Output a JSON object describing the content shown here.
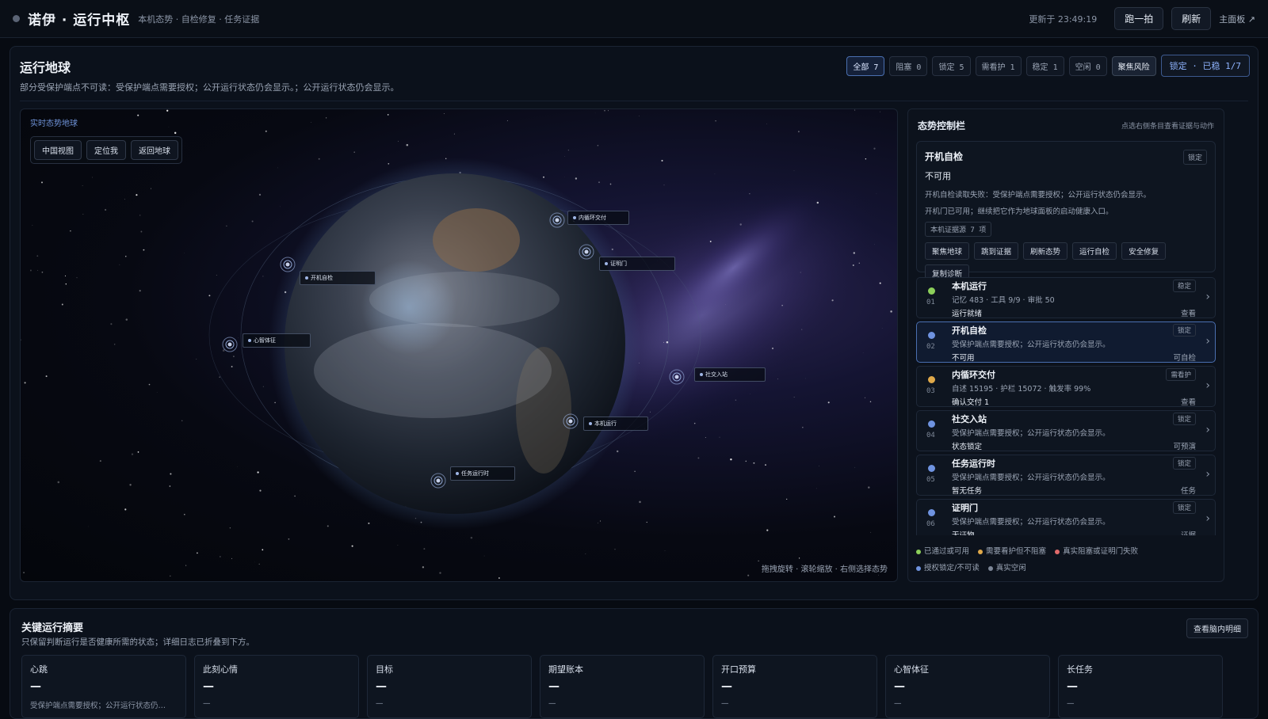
{
  "topbar": {
    "brand": "诺伊 · 运行中枢",
    "subtitle": "本机态势 · 自检修复 · 任务证据",
    "updated": "更新于 23:49:19",
    "btn_snapshot": "跑一拍",
    "btn_refresh": "刷新",
    "link_main": "主面板 ↗"
  },
  "panel": {
    "title": "运行地球",
    "desc": "部分受保护端点不可读：受保护端点需要授权；公开运行状态仍会显示。；公开运行状态仍会显示。",
    "filters": [
      "全部 7",
      "阻塞 0",
      "锁定 5",
      "需看护 1",
      "稳定 1",
      "空闲 0"
    ],
    "focus_risk": "聚焦风险",
    "lock_status": "锁定 · 已稳 1/7"
  },
  "globe": {
    "label": "实时态势地球",
    "btn_china": "中国视图",
    "btn_locate": "定位我",
    "btn_earth": "返回地球",
    "hint": "拖拽旋转 · 滚轮缩放 · 右侧选择态势",
    "nodes": [
      "开机自检",
      "内循环交付",
      "证明门",
      "心智体征",
      "社交入站",
      "本机运行",
      "任务运行时"
    ]
  },
  "side": {
    "title": "态势控制栏",
    "hint": "点选右侧条目查看证据与动作",
    "detail": {
      "title": "开机自检",
      "badge": "锁定",
      "state": "不可用",
      "line1": "开机自检读取失败：受保护端点需要授权；公开运行状态仍会显示。",
      "line2": "开机门已可用；继续把它作为地球面板的启动健康入口。",
      "source": "本机证据源 7 项",
      "actions": [
        "聚焦地球",
        "跳到证据",
        "刷新态势",
        "运行自检",
        "安全修复",
        "复制诊断"
      ]
    },
    "rows": [
      {
        "num": "01",
        "title": "本机运行",
        "badge": "稳定",
        "sub": "记忆 483 · 工具 9/9 · 审批 50",
        "foot": "运行就绪",
        "action": "查看",
        "color": "#8ccf5a"
      },
      {
        "num": "02",
        "title": "开机自检",
        "badge": "锁定",
        "sub": "受保护端点需要授权；公开运行状态仍会显示。",
        "foot": "不可用",
        "action": "可自检",
        "color": "#6f93e0"
      },
      {
        "num": "03",
        "title": "内循环交付",
        "badge": "需看护",
        "sub": "自述 15195 · 护栏 15072 · 触发率 99%",
        "foot": "确认交付 1",
        "action": "查看",
        "color": "#e0a94a"
      },
      {
        "num": "04",
        "title": "社交入站",
        "badge": "锁定",
        "sub": "受保护端点需要授权；公开运行状态仍会显示。",
        "foot": "状态锁定",
        "action": "可预演",
        "color": "#6f93e0"
      },
      {
        "num": "05",
        "title": "任务运行时",
        "badge": "锁定",
        "sub": "受保护端点需要授权；公开运行状态仍会显示。",
        "foot": "暂无任务",
        "action": "任务",
        "color": "#6f93e0"
      },
      {
        "num": "06",
        "title": "证明门",
        "badge": "锁定",
        "sub": "受保护端点需要授权；公开运行状态仍会显示。",
        "foot": "无证物",
        "action": "证据",
        "color": "#6f93e0"
      }
    ],
    "legend": [
      {
        "label": "已通过或可用",
        "color": "#8ccf5a"
      },
      {
        "label": "需要看护但不阻塞",
        "color": "#e0a94a"
      },
      {
        "label": "真实阻塞或证明门失败",
        "color": "#e06a6a"
      },
      {
        "label": "授权锁定/不可读",
        "color": "#6f93e0"
      },
      {
        "label": "真实空闲",
        "color": "#7d8797"
      }
    ]
  },
  "summary": {
    "title": "关键运行摘要",
    "desc": "只保留判断运行是否健康所需的状态；详细日志已折叠到下方。",
    "btn": "查看脑内明细",
    "cards": [
      {
        "label": "心跳",
        "value": "—",
        "note": "受保护端点需要授权；公开运行状态仍…"
      },
      {
        "label": "此刻心情",
        "value": "—",
        "note": "—"
      },
      {
        "label": "目标",
        "value": "—",
        "note": "—"
      },
      {
        "label": "期望账本",
        "value": "—",
        "note": "—"
      },
      {
        "label": "开口预算",
        "value": "—",
        "note": "—"
      },
      {
        "label": "心智体征",
        "value": "—",
        "note": "—"
      },
      {
        "label": "长任务",
        "value": "—",
        "note": "—"
      }
    ]
  }
}
